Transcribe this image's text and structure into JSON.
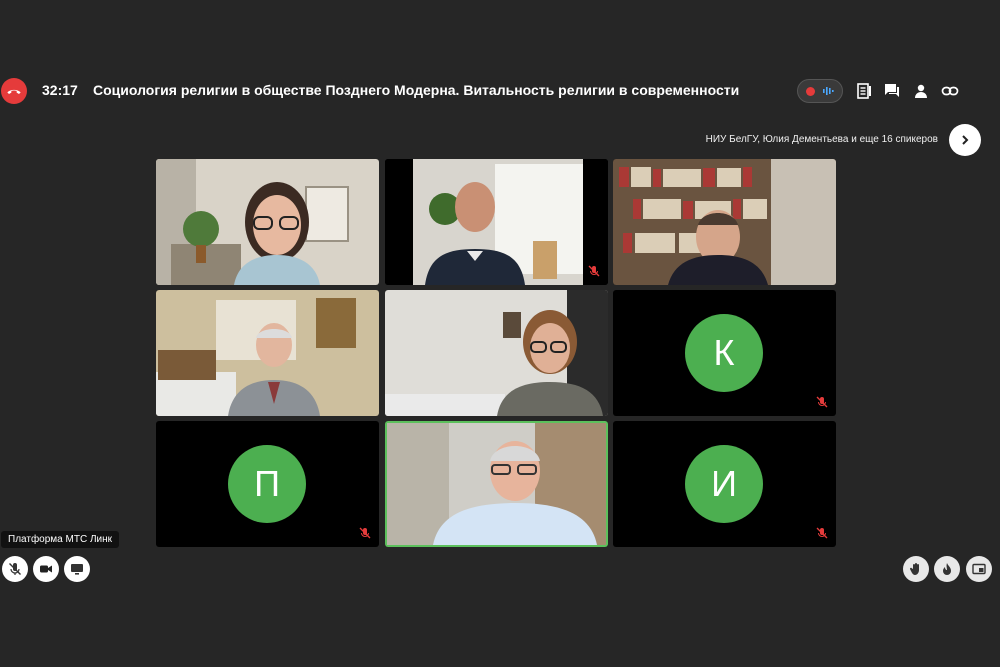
{
  "header": {
    "timer": "32:17",
    "title": "Социология религии в обществе Позднего Модерна. Витальность религии в современности"
  },
  "speakers": {
    "summary": "НИУ БелГУ, Юлия Дементьева и еще 16 спикеров"
  },
  "tiles": [
    {
      "type": "video",
      "scene": "woman-glasses-smiling"
    },
    {
      "type": "video",
      "scene": "bald-man-suit"
    },
    {
      "type": "video",
      "scene": "man-headset-bookshelf"
    },
    {
      "type": "video",
      "scene": "older-man-office"
    },
    {
      "type": "video",
      "scene": "woman-glasses-office"
    },
    {
      "type": "avatar",
      "initial": "К",
      "muted": true
    },
    {
      "type": "avatar",
      "initial": "П",
      "muted": true
    },
    {
      "type": "video",
      "scene": "man-glasses-laughing",
      "active": true
    },
    {
      "type": "avatar",
      "initial": "И",
      "muted": true
    }
  ],
  "footer": {
    "tooltip": "Платформа МТС Линк"
  },
  "colors": {
    "background": "#262626",
    "hangup": "#e53b3b",
    "avatar": "#4caf50",
    "active_border": "#5cc05c",
    "muted_icon": "#e53b3b"
  }
}
